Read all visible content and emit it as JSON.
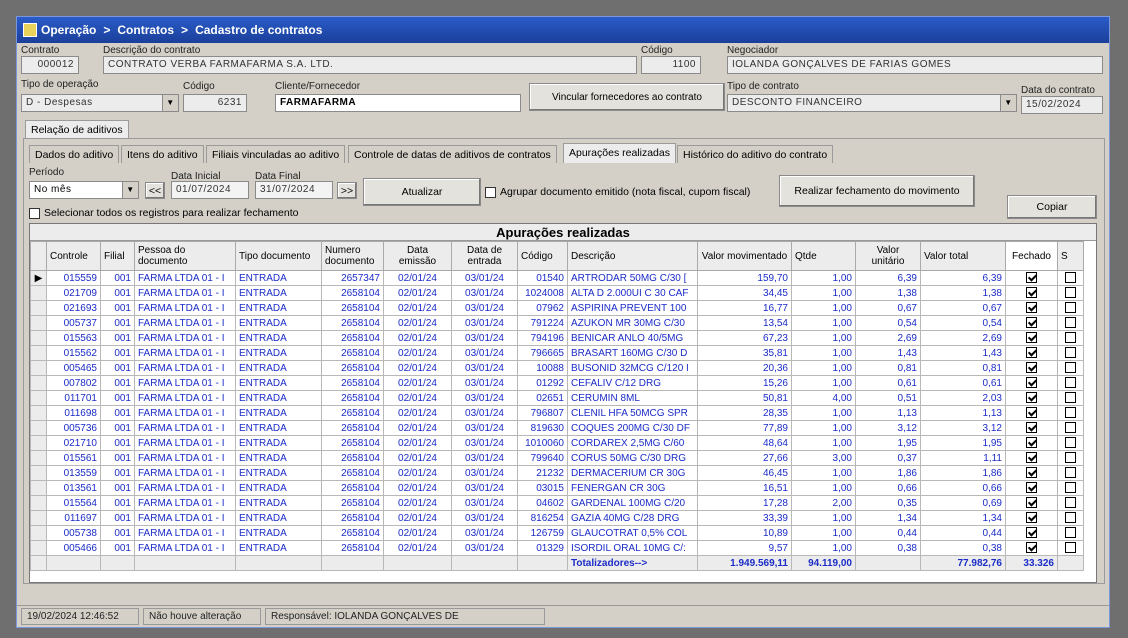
{
  "breadcrumb": {
    "part1": "Operação",
    "part2": "Contratos",
    "part3": "Cadastro de contratos",
    "separator": ">"
  },
  "header": {
    "contrato_label": "Contrato",
    "contrato_value": "000012",
    "descricao_label": "Descrição do contrato",
    "descricao_value": "CONTRATO VERBA FARMAFARMA S.A. LTD.",
    "codigo_label": "Código",
    "codigo_value": "1100",
    "negociador_label": "Negociador",
    "negociador_value": "IOLANDA GONÇALVES DE FARIAS GOMES",
    "tipo_operacao_label": "Tipo de operação",
    "tipo_operacao_value": "D - Despesas",
    "codigo2_label": "Código",
    "codigo2_value": "6231",
    "cliente_label": "Cliente/Fornecedor",
    "cliente_value": "FARMAFARMA",
    "vincular_label": "Vincular fornecedores ao contrato",
    "tipo_contrato_label": "Tipo de contrato",
    "tipo_contrato_value": "DESCONTO FINANCEIRO",
    "data_contrato_label": "Data do contrato",
    "data_contrato_value": "15/02/2024"
  },
  "outer_tab": "Relação de aditivos",
  "tabs": [
    "Dados do aditivo",
    "Itens do aditivo",
    "Filiais vinculadas ao aditivo",
    "Controle de datas de aditivos de contratos",
    "Apurações realizadas",
    "Histórico do aditivo do contrato"
  ],
  "filters": {
    "periodo_label": "Período",
    "periodo_value": "No mês",
    "prev_label": "<<",
    "next_label": ">>",
    "data_inicial_label": "Data Inicial",
    "data_inicial_value": "01/07/2024",
    "data_final_label": "Data Final",
    "data_final_value": "31/07/2024",
    "atualizar_label": "Atualizar",
    "agrupar_label": "Agrupar documento emitido (nota fiscal, cupom fiscal)",
    "fechamento_label": "Realizar fechamento do movimento",
    "selecionar_label": "Selecionar todos os registros para realizar fechamento",
    "copiar_label": "Copiar"
  },
  "grid": {
    "title": "Apurações realizadas",
    "columns": [
      "Controle",
      "Filial",
      "Pessoa do documento",
      "Tipo documento",
      "Numero documento",
      "Data emissão",
      "Data de entrada",
      "Código",
      "Descrição",
      "Valor movimentado",
      "Qtde",
      "Valor unitário",
      "Valor total",
      "Fechado",
      "S"
    ],
    "rows": [
      [
        "015559",
        "001",
        "FARMA LTDA 01 - I",
        "ENTRADA",
        "2657347",
        "02/01/24",
        "03/01/24",
        "01540",
        "ARTRODAR 50MG C/30 [",
        "159,70",
        "1,00",
        "6,39",
        "6,39"
      ],
      [
        "021709",
        "001",
        "FARMA LTDA 01 - I",
        "ENTRADA",
        "2658104",
        "02/01/24",
        "03/01/24",
        "1024008",
        "ALTA D 2.000UI C 30 CAF",
        "34,45",
        "1,00",
        "1,38",
        "1,38"
      ],
      [
        "021693",
        "001",
        "FARMA LTDA 01 - I",
        "ENTRADA",
        "2658104",
        "02/01/24",
        "03/01/24",
        "07962",
        "ASPIRINA PREVENT 100",
        "16,77",
        "1,00",
        "0,67",
        "0,67"
      ],
      [
        "005737",
        "001",
        "FARMA LTDA 01 - I",
        "ENTRADA",
        "2658104",
        "02/01/24",
        "03/01/24",
        "791224",
        "AZUKON MR 30MG C/30",
        "13,54",
        "1,00",
        "0,54",
        "0,54"
      ],
      [
        "015563",
        "001",
        "FARMA LTDA 01 - I",
        "ENTRADA",
        "2658104",
        "02/01/24",
        "03/01/24",
        "794196",
        "BENICAR ANLO 40/5MG",
        "67,23",
        "1,00",
        "2,69",
        "2,69"
      ],
      [
        "015562",
        "001",
        "FARMA LTDA 01 - I",
        "ENTRADA",
        "2658104",
        "02/01/24",
        "03/01/24",
        "796665",
        "BRASART 160MG C/30 D",
        "35,81",
        "1,00",
        "1,43",
        "1,43"
      ],
      [
        "005465",
        "001",
        "FARMA LTDA 01 - I",
        "ENTRADA",
        "2658104",
        "02/01/24",
        "03/01/24",
        "10088",
        "BUSONID 32MCG C/120 I",
        "20,36",
        "1,00",
        "0,81",
        "0,81"
      ],
      [
        "007802",
        "001",
        "FARMA LTDA 01 - I",
        "ENTRADA",
        "2658104",
        "02/01/24",
        "03/01/24",
        "01292",
        "CEFALIV C/12 DRG",
        "15,26",
        "1,00",
        "0,61",
        "0,61"
      ],
      [
        "011701",
        "001",
        "FARMA LTDA 01 - I",
        "ENTRADA",
        "2658104",
        "02/01/24",
        "03/01/24",
        "02651",
        "CERUMIN 8ML",
        "50,81",
        "4,00",
        "0,51",
        "2,03"
      ],
      [
        "011698",
        "001",
        "FARMA LTDA 01 - I",
        "ENTRADA",
        "2658104",
        "02/01/24",
        "03/01/24",
        "796807",
        "CLENIL HFA 50MCG SPR",
        "28,35",
        "1,00",
        "1,13",
        "1,13"
      ],
      [
        "005736",
        "001",
        "FARMA LTDA 01 - I",
        "ENTRADA",
        "2658104",
        "02/01/24",
        "03/01/24",
        "819630",
        "COQUES 200MG C/30 DF",
        "77,89",
        "1,00",
        "3,12",
        "3,12"
      ],
      [
        "021710",
        "001",
        "FARMA LTDA 01 - I",
        "ENTRADA",
        "2658104",
        "02/01/24",
        "03/01/24",
        "1010060",
        "CORDAREX 2,5MG C/60",
        "48,64",
        "1,00",
        "1,95",
        "1,95"
      ],
      [
        "015561",
        "001",
        "FARMA LTDA 01 - I",
        "ENTRADA",
        "2658104",
        "02/01/24",
        "03/01/24",
        "799640",
        "CORUS 50MG C/30 DRG",
        "27,66",
        "3,00",
        "0,37",
        "1,11"
      ],
      [
        "013559",
        "001",
        "FARMA LTDA 01 - I",
        "ENTRADA",
        "2658104",
        "02/01/24",
        "03/01/24",
        "21232",
        "DERMACERIUM CR 30G",
        "46,45",
        "1,00",
        "1,86",
        "1,86"
      ],
      [
        "013561",
        "001",
        "FARMA LTDA 01 - I",
        "ENTRADA",
        "2658104",
        "02/01/24",
        "03/01/24",
        "03015",
        "FENERGAN CR 30G",
        "16,51",
        "1,00",
        "0,66",
        "0,66"
      ],
      [
        "015564",
        "001",
        "FARMA LTDA 01 - I",
        "ENTRADA",
        "2658104",
        "02/01/24",
        "03/01/24",
        "04602",
        "GARDENAL 100MG C/20",
        "17,28",
        "2,00",
        "0,35",
        "0,69"
      ],
      [
        "011697",
        "001",
        "FARMA LTDA 01 - I",
        "ENTRADA",
        "2658104",
        "02/01/24",
        "03/01/24",
        "816254",
        "GAZIA 40MG C/28 DRG",
        "33,39",
        "1,00",
        "1,34",
        "1,34"
      ],
      [
        "005738",
        "001",
        "FARMA LTDA 01 - I",
        "ENTRADA",
        "2658104",
        "02/01/24",
        "03/01/24",
        "126759",
        "GLAUCOTRAT 0,5% COL",
        "10,89",
        "1,00",
        "0,44",
        "0,44"
      ],
      [
        "005466",
        "001",
        "FARMA LTDA 01 - I",
        "ENTRADA",
        "2658104",
        "02/01/24",
        "03/01/24",
        "01329",
        "ISORDIL ORAL 10MG C/:",
        "9,57",
        "1,00",
        "0,38",
        "0,38"
      ]
    ],
    "totals": {
      "label": "Totalizadores-->",
      "valor_movimentado": "1.949.569,11",
      "qtde": "94.119,00",
      "valor_total": "77.982,76",
      "fechado": "33.326"
    }
  },
  "status": {
    "datetime": "19/02/2024 12:46:52",
    "message": "Não houve alteração",
    "responsavel": "Responsável: IOLANDA GONÇALVES DE"
  }
}
